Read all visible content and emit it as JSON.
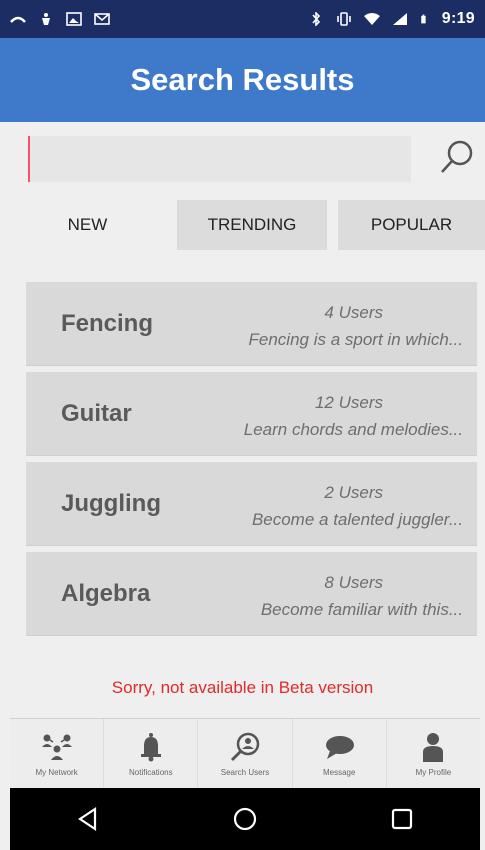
{
  "status_bar": {
    "time": "9:19",
    "left_icons": [
      "cast-icon",
      "vpn-icon",
      "image-icon",
      "gmail-icon"
    ],
    "right_icons": [
      "bluetooth-icon",
      "vibrate-icon",
      "wifi-icon",
      "signal-icon",
      "battery-icon"
    ]
  },
  "header": {
    "title": "Search Results"
  },
  "search": {
    "value": "",
    "placeholder": ""
  },
  "tabs": [
    {
      "label": "NEW"
    },
    {
      "label": "TRENDING"
    },
    {
      "label": "POPULAR"
    }
  ],
  "results": [
    {
      "title": "Fencing",
      "users": "4 Users",
      "description": "Fencing is a sport in which..."
    },
    {
      "title": "Guitar",
      "users": "12 Users",
      "description": "Learn chords and melodies..."
    },
    {
      "title": "Juggling",
      "users": "2 Users",
      "description": "Become a talented juggler..."
    },
    {
      "title": "Algebra",
      "users": "8 Users",
      "description": "Become familiar with this..."
    }
  ],
  "notice": "Sorry, not available in Beta version",
  "bottom_nav": [
    {
      "label": "My Network",
      "icon": "network-icon"
    },
    {
      "label": "Notifications",
      "icon": "bell-icon"
    },
    {
      "label": "Search Users",
      "icon": "search-user-icon"
    },
    {
      "label": "Message",
      "icon": "chat-bubble-icon"
    },
    {
      "label": "My Profile",
      "icon": "profile-icon"
    }
  ],
  "colors": {
    "status_bar": "#1c2d63",
    "app_bar": "#3f79c9",
    "notice": "#e02b2b",
    "card": "#d9d9d9"
  }
}
